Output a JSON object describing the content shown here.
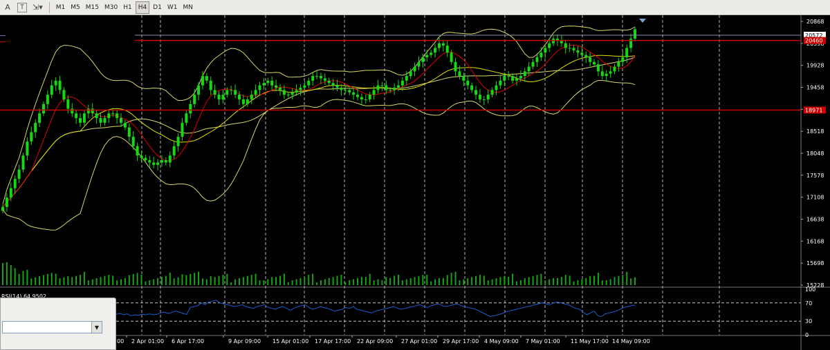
{
  "toolbar": {
    "tools": [
      {
        "name": "text-tool-icon",
        "glyph": "A"
      },
      {
        "name": "text-label-tool-icon",
        "glyph": "T"
      },
      {
        "name": "arrows-tool-icon",
        "glyph": "⇲▾"
      }
    ],
    "timeframes": [
      "M1",
      "M5",
      "M15",
      "M30",
      "H1",
      "H4",
      "D1",
      "W1",
      "MN"
    ],
    "active_timeframe": "H4"
  },
  "colors": {
    "bull": "#16d916",
    "volume": "#16a416",
    "grid": "#c8c8c8",
    "support": "#cc0000",
    "ma_red": "#e00000",
    "ma_yellow": "#e0e000",
    "bb": "#d8d86a",
    "rsi": "#1e5ecf",
    "axis_text": "#ffffff"
  },
  "main_axis": {
    "labels": [
      "20868",
      "20398",
      "19928",
      "19458",
      "18988",
      "18518",
      "18048",
      "17578",
      "17108",
      "16638",
      "16168",
      "15698",
      "15228"
    ],
    "ylim": [
      15228,
      20868
    ]
  },
  "price_tags": [
    {
      "label": "20572",
      "value": 20572,
      "bg": "#ffffff",
      "fg": "#000000"
    },
    {
      "label": "20460",
      "value": 20460,
      "bg": "#cc0000",
      "fg": "#ffffff"
    },
    {
      "label": "18971",
      "value": 18971,
      "bg": "#cc0000",
      "fg": "#ffffff"
    }
  ],
  "rsi": {
    "title": "RSI(14) 64.9502",
    "axis_labels": [
      "100",
      "70",
      "30",
      "0"
    ],
    "levels": [
      70,
      30
    ],
    "values": [
      45,
      47,
      44,
      46,
      42,
      44,
      43,
      45,
      44,
      46,
      44,
      45,
      48,
      50,
      47,
      49,
      52,
      50,
      47,
      45,
      60,
      62,
      64,
      70,
      66,
      72,
      74,
      76,
      70,
      68,
      66,
      64,
      62,
      64,
      66,
      62,
      60,
      58,
      62,
      64,
      66,
      60,
      58,
      56,
      60,
      62,
      58,
      54,
      58,
      62,
      64,
      66,
      60,
      56,
      58,
      62,
      60,
      58,
      55,
      52,
      54,
      56,
      60,
      58,
      62,
      56,
      54,
      52,
      50,
      48,
      52,
      54,
      56,
      58,
      60,
      62,
      58,
      56,
      58,
      60,
      62,
      64,
      66,
      62,
      60,
      64,
      66,
      68,
      64,
      62,
      64,
      66,
      68,
      64,
      62,
      60,
      58,
      56,
      52,
      48,
      44,
      40,
      42,
      44,
      46,
      50,
      52,
      54,
      56,
      58,
      60,
      62,
      64,
      66,
      68,
      70,
      68,
      66,
      70,
      72,
      70,
      68,
      66,
      62,
      58,
      56,
      50,
      44,
      48,
      52,
      42,
      40,
      46,
      48,
      50,
      52,
      56,
      60,
      62,
      64,
      65
    ]
  },
  "x_labels": [
    "2 Apr 01:00",
    "6 Apr 17:00",
    "9 Apr 09:00",
    "15 Apr 01:00",
    "17 Apr 17:00",
    "22 Apr 09:00",
    "27 Apr 01:00",
    "29 Apr 17:00",
    "4 May 09:00",
    "7 May 01:00",
    "11 May 17:00",
    "14 May 09:00"
  ],
  "x_label_partial": "00",
  "chart_data": [
    {
      "type": "line",
      "title": "",
      "note": "H4 price chart with Bollinger Bands, moving averages and volume",
      "series": [
        {
          "name": "",
          "values": [
            16900,
            17100,
            17300,
            17500,
            17700,
            18000,
            18300,
            18500,
            18700,
            18900,
            19100,
            19300,
            19500,
            19600,
            19400,
            19200,
            19000,
            18900,
            18800,
            18700,
            18900,
            19000,
            18900,
            18800,
            18700,
            18800,
            18900,
            18900,
            18800,
            18700,
            18600,
            18400,
            18200,
            18000,
            17950,
            17900,
            17850,
            17800,
            17850,
            17900,
            17850,
            18000,
            18200,
            18400,
            18700,
            18900,
            19100,
            19300,
            19500,
            19700,
            19600,
            19400,
            19300,
            19200,
            19300,
            19400,
            19400,
            19300,
            19200,
            19100,
            19200,
            19300,
            19400,
            19500,
            19550,
            19600,
            19500,
            19450,
            19400,
            19300,
            19300,
            19350,
            19400,
            19450,
            19500,
            19600,
            19700,
            19700,
            19650,
            19600,
            19550,
            19500,
            19450,
            19400,
            19400,
            19350,
            19300,
            19250,
            19200,
            19200,
            19300,
            19400,
            19500,
            19500,
            19400,
            19400,
            19450,
            19500,
            19600,
            19700,
            19800,
            19900,
            20000,
            20100,
            20150,
            20200,
            20300,
            20400,
            20350,
            20200,
            20000,
            19800,
            19700,
            19600,
            19500,
            19400,
            19300,
            19200,
            19200,
            19300,
            19400,
            19500,
            19600,
            19700,
            19700,
            19600,
            19650,
            19700,
            19800,
            19900,
            20000,
            20100,
            20200,
            20300,
            20400,
            20500,
            20450,
            20400,
            20300,
            20300,
            20250,
            20200,
            20150,
            20100,
            20000,
            19950,
            19800,
            19700,
            19750,
            19800,
            19900,
            20000,
            20100,
            20300,
            20500,
            20700
          ]
        }
      ],
      "ylim": [
        15228,
        20868
      ]
    },
    {
      "type": "line",
      "title": "RSI(14) 64.9502",
      "ylim": [
        0,
        100
      ]
    }
  ]
}
